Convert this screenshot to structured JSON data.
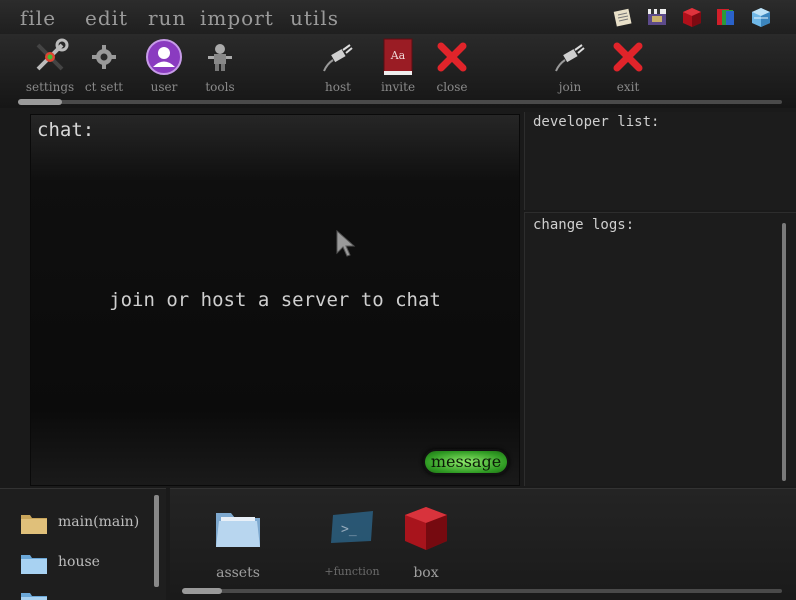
{
  "menu": {
    "items": [
      {
        "label": "file"
      },
      {
        "label": "edit"
      },
      {
        "label": "run"
      },
      {
        "label": "import"
      },
      {
        "label": "utils"
      }
    ],
    "tray_icons": [
      "notepad-icon",
      "clapperboard-icon",
      "red-cube-icon",
      "color-cards-icon",
      "blue-box-icon"
    ]
  },
  "toolbar": {
    "settings_label": "settings",
    "project_settings_label": "ct sett",
    "user_label": "user",
    "tools_label": "tools",
    "host_label": "host",
    "invite_label": "invite",
    "invite_book_text": "Aa",
    "close_label": "close",
    "join_label": "join",
    "exit_label": "exit"
  },
  "chat": {
    "title": "chat:",
    "empty_message": "join or host a server to chat",
    "message_button": "message"
  },
  "developer_list": {
    "title": "developer list:"
  },
  "change_logs": {
    "title": "change logs:"
  },
  "tree": {
    "items": [
      {
        "label": "main(main)"
      },
      {
        "label": "house"
      }
    ]
  },
  "assets": {
    "items": [
      {
        "label": "assets"
      },
      {
        "label": "+function"
      },
      {
        "label": "box"
      }
    ],
    "function_glyph": ">_"
  },
  "colors": {
    "background": "#1a1a1a",
    "close_red": "#e0242a",
    "message_green": "#3fae2b",
    "user_purple": "#8a3bc0"
  }
}
